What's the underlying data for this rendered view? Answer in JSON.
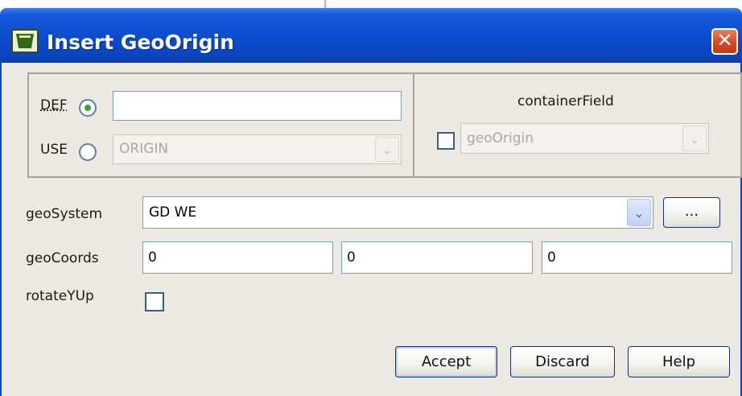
{
  "window": {
    "title": "Insert GeoOrigin",
    "close_glyph": "✕"
  },
  "def_use": {
    "def_label": "DEF",
    "def_value": "",
    "def_selected": true,
    "use_label": "USE",
    "use_value": "ORIGIN",
    "use_selected": false
  },
  "container_field": {
    "heading": "containerField",
    "checked": false,
    "value": "geoOrigin"
  },
  "form": {
    "geo_system_label": "geoSystem",
    "geo_system_value": "GD WE",
    "browse_label": "...",
    "geo_coords_label": "geoCoords",
    "geo_coords": [
      "0",
      "0",
      "0"
    ],
    "rotate_y_up_label": "rotateYUp",
    "rotate_y_up_checked": false
  },
  "buttons": {
    "accept": "Accept",
    "discard": "Discard",
    "help": "Help"
  },
  "icons": {
    "app": "x3d-edit-app-icon",
    "close": "close-icon",
    "dropdown": "chevron-down-icon"
  },
  "colors": {
    "titlebar": "#0a4ccc",
    "close": "#d44a22",
    "dialog_bg": "#ebe9e1",
    "radio_selected": "#3aa03a"
  }
}
